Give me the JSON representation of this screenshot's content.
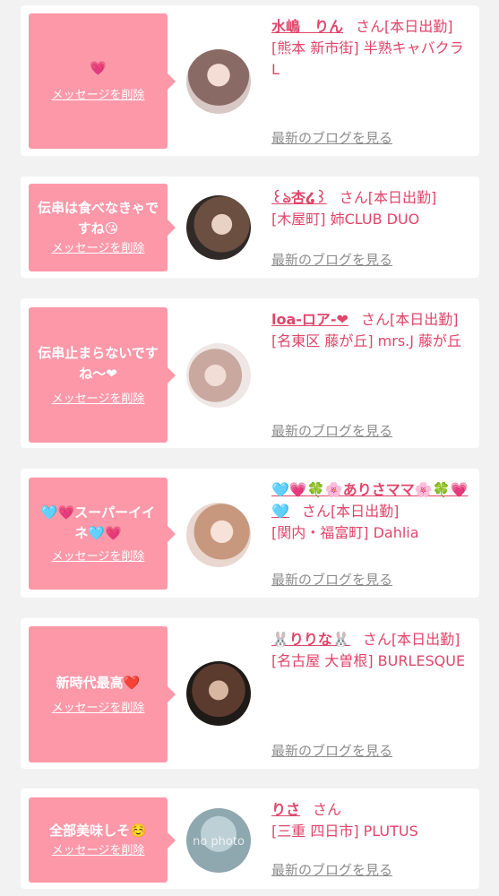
{
  "accent_color": "#e0456a",
  "bubble_color": "#fd98a8",
  "link_color": "#8c8c8c",
  "delete_label": "メッセージを削除",
  "blog_label": "最新のブログを見る",
  "san_label": "さん",
  "cards": [
    {
      "message": "💗",
      "name": "水嶋　りん",
      "status": "[本日出勤]",
      "shop": "[熊本 新市街] 半熟キャバクラ L"
    },
    {
      "message": "伝串は食べなきゃですね😘",
      "name": "꒰ঌ杏໒꒱",
      "status": "[本日出勤]",
      "shop": "[木屋町] 姉CLUB DUO"
    },
    {
      "message": "伝串止まらないですね〜❤",
      "name": "loa-ロア-❤",
      "status": "[本日出勤]",
      "shop": "[名東区 藤が丘] mrs.J 藤が丘"
    },
    {
      "message": "🩵💗スーパーイイネ🩵💗",
      "name": "🩵💗🍀🌸ありさママ🌸🍀💗🩵",
      "status": "[本日出勤]",
      "shop": "[関内・福富町] Dahlia"
    },
    {
      "message": "新時代最高❤️",
      "name": "🐰りりな🐰",
      "status": "[本日出勤]",
      "shop": "[名古屋 大曽根] BURLESQUE"
    },
    {
      "message": "全部美味しそ☺️",
      "name": "りさ",
      "status": "",
      "shop": "[三重 四日市] PLUTUS",
      "avatar_text": "no photo"
    }
  ]
}
